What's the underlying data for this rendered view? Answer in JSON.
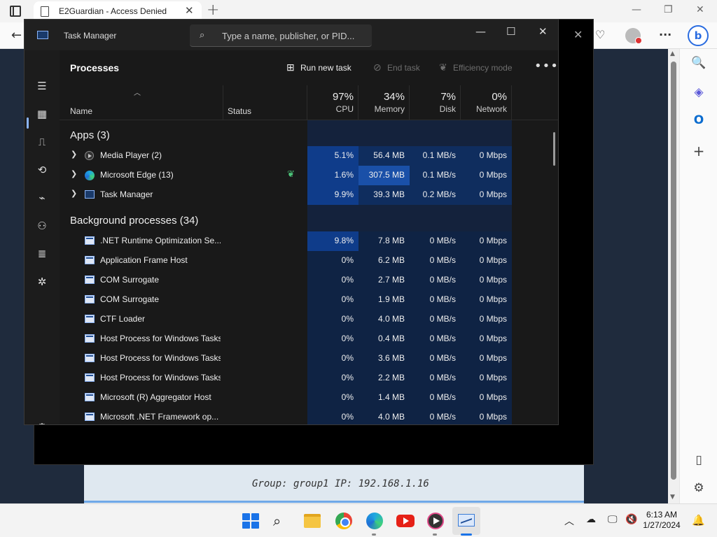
{
  "browser": {
    "tab_title": "E2Guardian - Access Denied",
    "tab_close": "✕",
    "new_tab": "+",
    "minimize": "—",
    "restore": "❐",
    "close": "✕"
  },
  "page": {
    "group_text": "Group: group1   IP: 192.168.1.16"
  },
  "task_manager": {
    "title": "Task Manager",
    "search_placeholder": "Type a name, publisher, or PID...",
    "page_title": "Processes",
    "commands": {
      "run_new_task": "Run new task",
      "end_task": "End task",
      "efficiency_mode": "Efficiency mode",
      "more": "•••"
    },
    "columns": {
      "name": "Name",
      "status": "Status",
      "cpu_pct": "97%",
      "cpu": "CPU",
      "memory_pct": "34%",
      "memory": "Memory",
      "disk_pct": "7%",
      "disk": "Disk",
      "network_pct": "0%",
      "network": "Network"
    },
    "apps_label": "Apps (3)",
    "apps": [
      {
        "name": "Media Player (2)",
        "cpu": "5.1%",
        "memory": "56.4 MB",
        "disk": "0.1 MB/s",
        "network": "0 Mbps"
      },
      {
        "name": "Microsoft Edge (13)",
        "cpu": "1.6%",
        "memory": "307.5 MB",
        "disk": "0.1 MB/s",
        "network": "0 Mbps"
      },
      {
        "name": "Task Manager",
        "cpu": "9.9%",
        "memory": "39.3 MB",
        "disk": "0.2 MB/s",
        "network": "0 Mbps"
      }
    ],
    "background_label": "Background processes (34)",
    "background": [
      {
        "name": ".NET Runtime Optimization Se...",
        "cpu": "9.8%",
        "memory": "7.8 MB",
        "disk": "0 MB/s",
        "network": "0 Mbps"
      },
      {
        "name": "Application Frame Host",
        "cpu": "0%",
        "memory": "6.2 MB",
        "disk": "0 MB/s",
        "network": "0 Mbps"
      },
      {
        "name": "COM Surrogate",
        "cpu": "0%",
        "memory": "2.7 MB",
        "disk": "0 MB/s",
        "network": "0 Mbps"
      },
      {
        "name": "COM Surrogate",
        "cpu": "0%",
        "memory": "1.9 MB",
        "disk": "0 MB/s",
        "network": "0 Mbps"
      },
      {
        "name": "CTF Loader",
        "cpu": "0%",
        "memory": "4.0 MB",
        "disk": "0 MB/s",
        "network": "0 Mbps"
      },
      {
        "name": "Host Process for Windows Tasks",
        "cpu": "0%",
        "memory": "0.4 MB",
        "disk": "0 MB/s",
        "network": "0 Mbps"
      },
      {
        "name": "Host Process for Windows Tasks",
        "cpu": "0%",
        "memory": "3.6 MB",
        "disk": "0 MB/s",
        "network": "0 Mbps"
      },
      {
        "name": "Host Process for Windows Tasks",
        "cpu": "0%",
        "memory": "2.2 MB",
        "disk": "0 MB/s",
        "network": "0 Mbps"
      },
      {
        "name": "Microsoft (R) Aggregator Host",
        "cpu": "0%",
        "memory": "1.4 MB",
        "disk": "0 MB/s",
        "network": "0 Mbps"
      },
      {
        "name": "Microsoft .NET Framework op...",
        "cpu": "0%",
        "memory": "4.0 MB",
        "disk": "0 MB/s",
        "network": "0 Mbps"
      }
    ]
  },
  "taskbar": {
    "time": "6:13 AM",
    "date": "1/27/2024"
  },
  "colors": {
    "accent": "#8ab4f8",
    "cpu_heat": "#0f3c8a",
    "heat_low": "#0f2344",
    "efficiency_leaf": "#4cc77a"
  }
}
